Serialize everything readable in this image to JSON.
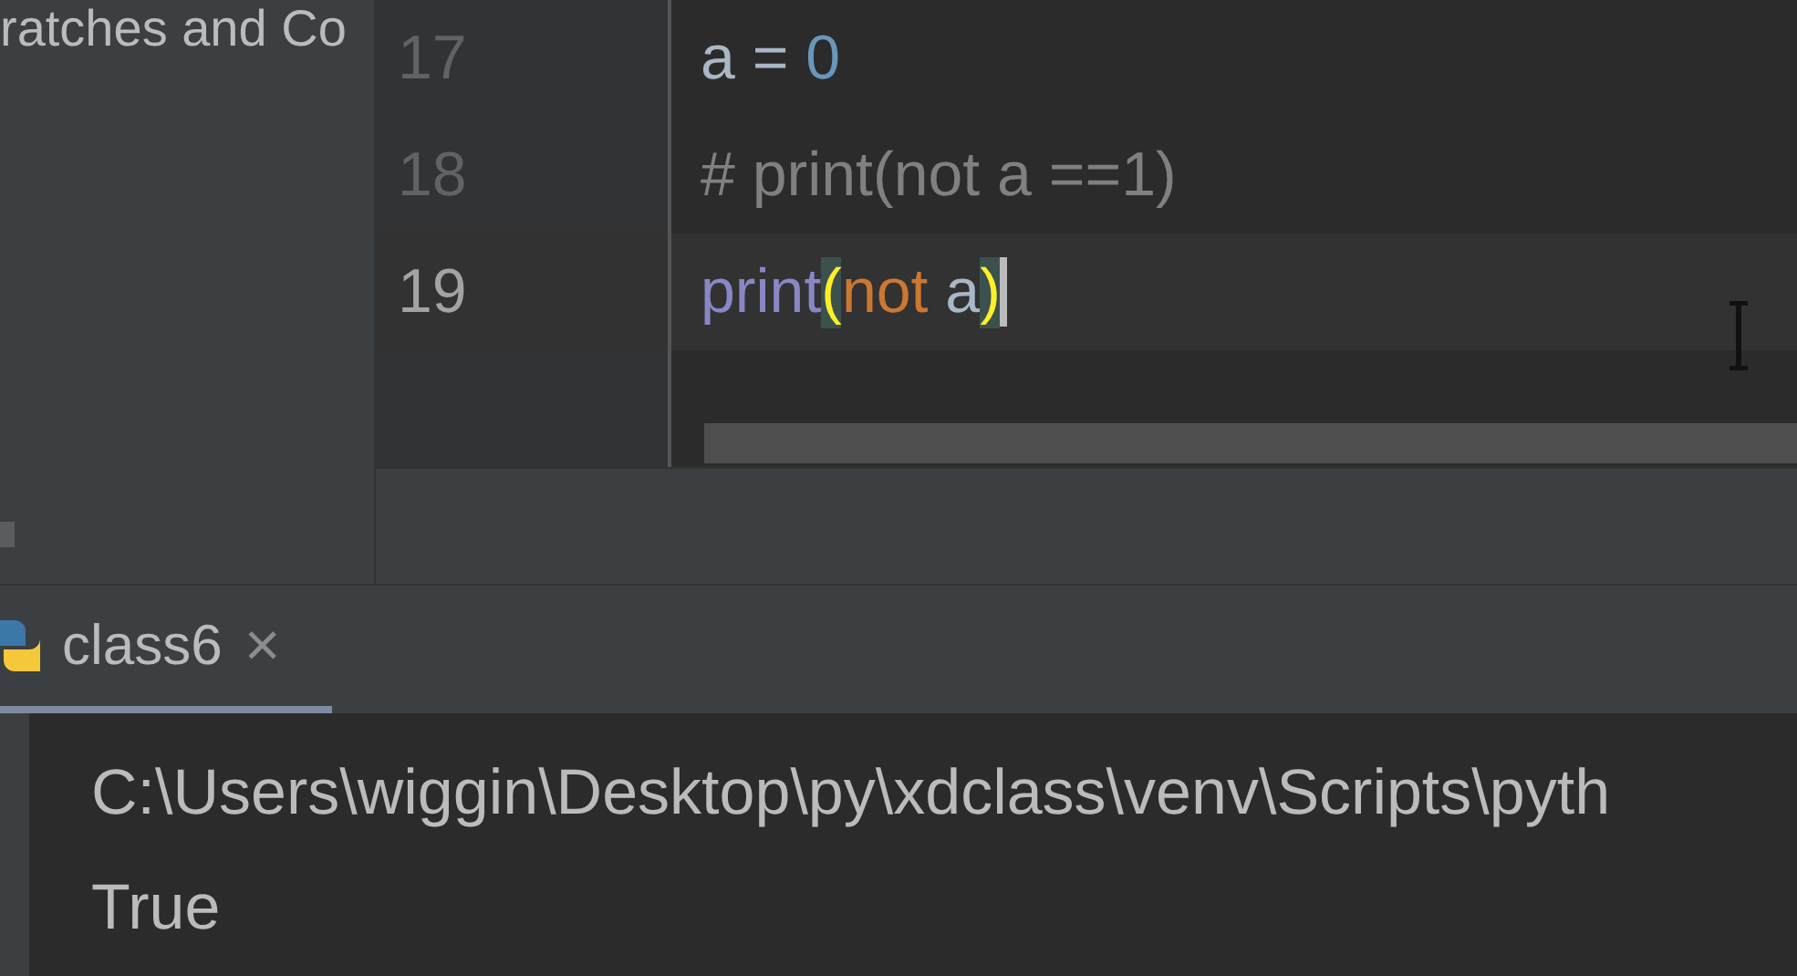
{
  "project_panel": {
    "item": "ratches and Co"
  },
  "editor": {
    "lines": [
      {
        "number": "17",
        "current": false,
        "caret": false,
        "segments": [
          {
            "kind": "plain",
            "text": "a"
          },
          {
            "kind": "plain",
            "text": " = "
          },
          {
            "kind": "number",
            "text": "0"
          }
        ]
      },
      {
        "number": "18",
        "current": false,
        "caret": false,
        "segments": [
          {
            "kind": "comment",
            "text": "# print(not a ==1)"
          }
        ]
      },
      {
        "number": "19",
        "current": true,
        "caret": true,
        "segments": [
          {
            "kind": "builtin",
            "text": "print"
          },
          {
            "kind": "brace-match",
            "text": "("
          },
          {
            "kind": "keyword",
            "text": "not"
          },
          {
            "kind": "plain",
            "text": " a"
          },
          {
            "kind": "brace-match",
            "text": ")"
          }
        ]
      }
    ]
  },
  "run_panel": {
    "tabs": [
      {
        "label": "class6",
        "close": "×",
        "selected": true
      }
    ],
    "console": [
      "C:\\Users\\wiggin\\Desktop\\py\\xdclass\\venv\\Scripts\\pyth",
      "True"
    ]
  }
}
